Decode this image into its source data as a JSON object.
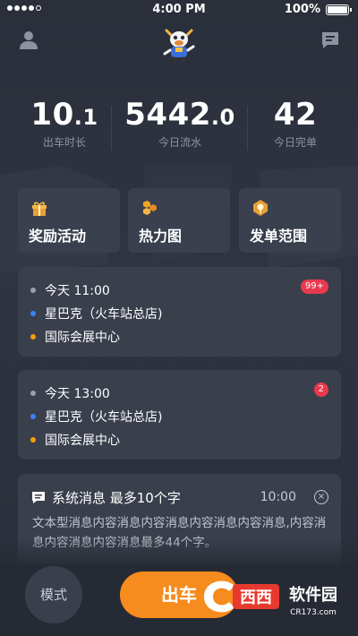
{
  "status_bar": {
    "time": "4:00 PM",
    "battery": "100%"
  },
  "stats": [
    {
      "value": "10",
      "unit": ".1",
      "label": "出车时长"
    },
    {
      "value": "5442",
      "unit": ".0",
      "label": "今日流水"
    },
    {
      "value": "42",
      "unit": "",
      "label": "今日完单"
    }
  ],
  "features": [
    {
      "label": "奖励活动",
      "icon": "gift-icon"
    },
    {
      "label": "热力图",
      "icon": "heatmap-icon"
    },
    {
      "label": "发单范围",
      "icon": "range-icon"
    }
  ],
  "orders": [
    {
      "time": "今天   11:00",
      "from": "星巴克（火车站总店)",
      "to": "国际会展中心",
      "badge": "99+"
    },
    {
      "time": "今天   13:00",
      "from": "星巴克（火车站总店)",
      "to": "国际会展中心",
      "badge": "2"
    }
  ],
  "system_message": {
    "title": "系统消息   最多10个字",
    "time": "10:00",
    "close": "×",
    "body": "文本型消息内容消息内容消息内容消息内容消息,内容消息内容消息内容消息最多44个字。"
  },
  "bottom": {
    "mode_label": "模式",
    "go_label": "出车"
  },
  "watermark": {
    "brand": "西西",
    "name": "软件园",
    "site": "CR173.com"
  },
  "colors": {
    "background": "#2b303c",
    "card": "#3a3f4c",
    "accent": "#f68b1e",
    "badge": "#e8394f"
  }
}
